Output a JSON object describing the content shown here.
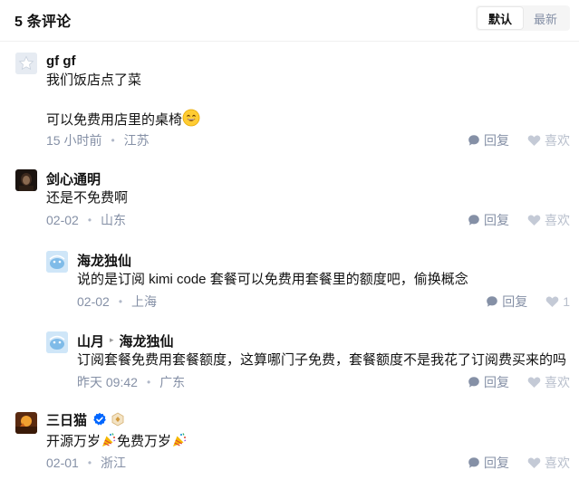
{
  "header": {
    "title": "5 条评论",
    "sort_default": "默认",
    "sort_latest": "最新"
  },
  "comments": [
    {
      "author": "gf gf",
      "lines": [
        "我们饭店点了菜",
        "可以免费用店里的桌椅"
      ],
      "emoji": "smile",
      "time": "15 小时前",
      "location": "江苏",
      "reply_label": "回复",
      "like_label": "喜欢"
    },
    {
      "author": "剑心通明",
      "text": "还是不免费啊",
      "time": "02-02",
      "location": "山东",
      "reply_label": "回复",
      "like_label": "喜欢"
    },
    {
      "author": "海龙独仙",
      "text": "说的是订阅 kimi code 套餐可以免费用套餐里的额度吧，偷换概念",
      "time": "02-02",
      "location": "上海",
      "reply_label": "回复",
      "like_count": "1"
    },
    {
      "author": "山月",
      "reply_to": "海龙独仙",
      "text": "订阅套餐免费用套餐额度，这算哪门子免费，套餐额度不是我花了订阅费买来的吗",
      "time": "昨天 09:42",
      "location": "广东",
      "reply_label": "回复",
      "like_label": "喜欢"
    },
    {
      "author": "三日猫",
      "text_a": "开源万岁",
      "text_b": "免费万岁",
      "emoji": "party-popper",
      "time": "02-01",
      "location": "浙江",
      "reply_label": "回复",
      "like_label": "喜欢"
    }
  ],
  "colors": {
    "text": "#121212",
    "meta": "#8590a6",
    "verified": "#0066ff",
    "divider": "#f0f0f0"
  },
  "icons": [
    "star-avatar-icon",
    "comment-bubble-icon",
    "heart-icon",
    "verified-icon",
    "level-badge-icon",
    "party-popper-icon",
    "smile-emoji-icon"
  ]
}
